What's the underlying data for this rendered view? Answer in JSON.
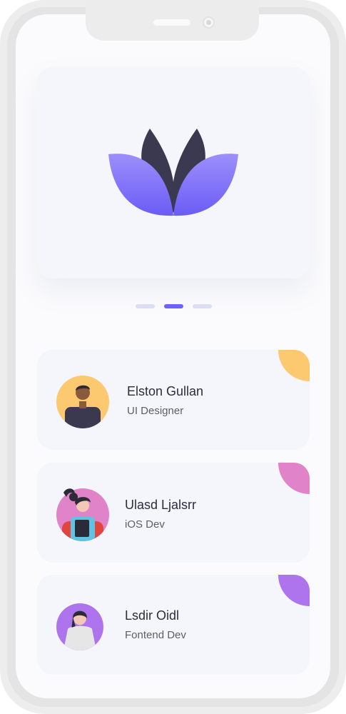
{
  "carousel": {
    "active_index": 2,
    "total": 3
  },
  "people": [
    {
      "name": "Elston Gullan",
      "role": "UI Designer",
      "accent": "#fcc870"
    },
    {
      "name": "Ulasd Ljalsrr",
      "role": "iOS Dev",
      "accent": "#e083c8"
    },
    {
      "name": "Lsdir Oidl",
      "role": "Fontend Dev",
      "accent": "#ad74ee"
    }
  ],
  "colors": {
    "primary": "#6c63ff",
    "card_bg": "#f5f6fb",
    "dot_inactive": "#dcdff3"
  },
  "icons": {
    "logo": "lotus-logo-icon"
  }
}
